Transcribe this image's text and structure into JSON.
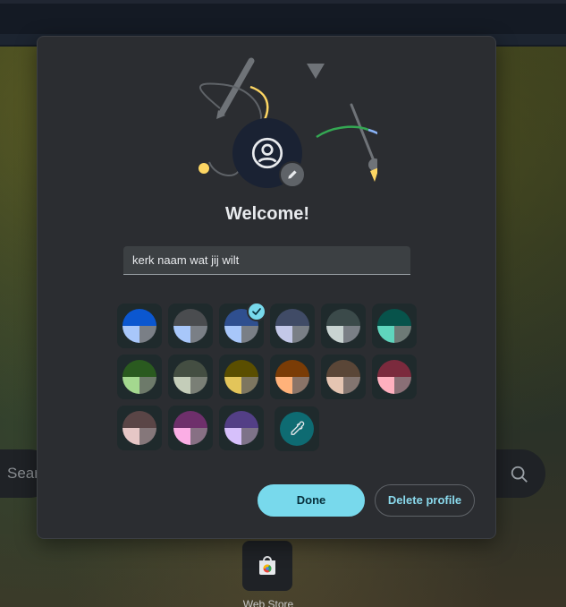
{
  "background": {
    "search_placeholder_fragment": "Sear",
    "webstore_label": "Web Store"
  },
  "dialog": {
    "title": "Welcome!",
    "name_field": {
      "value": "kerk naam wat jij wilt"
    },
    "colors": [
      {
        "name": "blue",
        "top": "#0b57d0",
        "left": "#a8c7fa",
        "right": "#7a7f86"
      },
      {
        "name": "grey",
        "top": "#4a4c4f",
        "left": "#a8c7fa",
        "right": "#7a7f86"
      },
      {
        "name": "navy-selected",
        "top": "#2f4f8f",
        "left": "#a8c7fa",
        "right": "#7a7f86",
        "selected": true
      },
      {
        "name": "slate",
        "top": "#404b66",
        "left": "#c3c8e8",
        "right": "#7a7f86"
      },
      {
        "name": "dark-teal-grey",
        "top": "#3b4a4a",
        "left": "#c9d4d2",
        "right": "#7a7f86"
      },
      {
        "name": "teal",
        "top": "#07534b",
        "left": "#5fd5bd",
        "right": "#6d7a76"
      },
      {
        "name": "green",
        "top": "#2a5a1f",
        "left": "#a4d88f",
        "right": "#6d7a6a"
      },
      {
        "name": "olive-grey",
        "top": "#444e42",
        "left": "#c4cdb9",
        "right": "#7a7f76"
      },
      {
        "name": "olive",
        "top": "#5a4e00",
        "left": "#e3c55a",
        "right": "#7d7660"
      },
      {
        "name": "orange",
        "top": "#7a3c06",
        "left": "#ffb27a",
        "right": "#8a7468"
      },
      {
        "name": "brown",
        "top": "#5a4637",
        "left": "#e5c5b2",
        "right": "#837570"
      },
      {
        "name": "crimson",
        "top": "#7b2a3d",
        "left": "#ffb0bf",
        "right": "#8a6f76"
      },
      {
        "name": "mauve",
        "top": "#5a4546",
        "left": "#e6c7c6",
        "right": "#85777a"
      },
      {
        "name": "magenta",
        "top": "#6e2f6b",
        "left": "#fbaee5",
        "right": "#877084"
      },
      {
        "name": "purple",
        "top": "#533f86",
        "left": "#d6c0fb",
        "right": "#7e7389"
      }
    ],
    "custom_color_icon": "eyedropper-icon",
    "done_label": "Done",
    "delete_label": "Delete profile"
  },
  "colors": {
    "accent": "#78d9ec",
    "dialog_bg": "#2b2d31",
    "text": "#e8eaed"
  }
}
